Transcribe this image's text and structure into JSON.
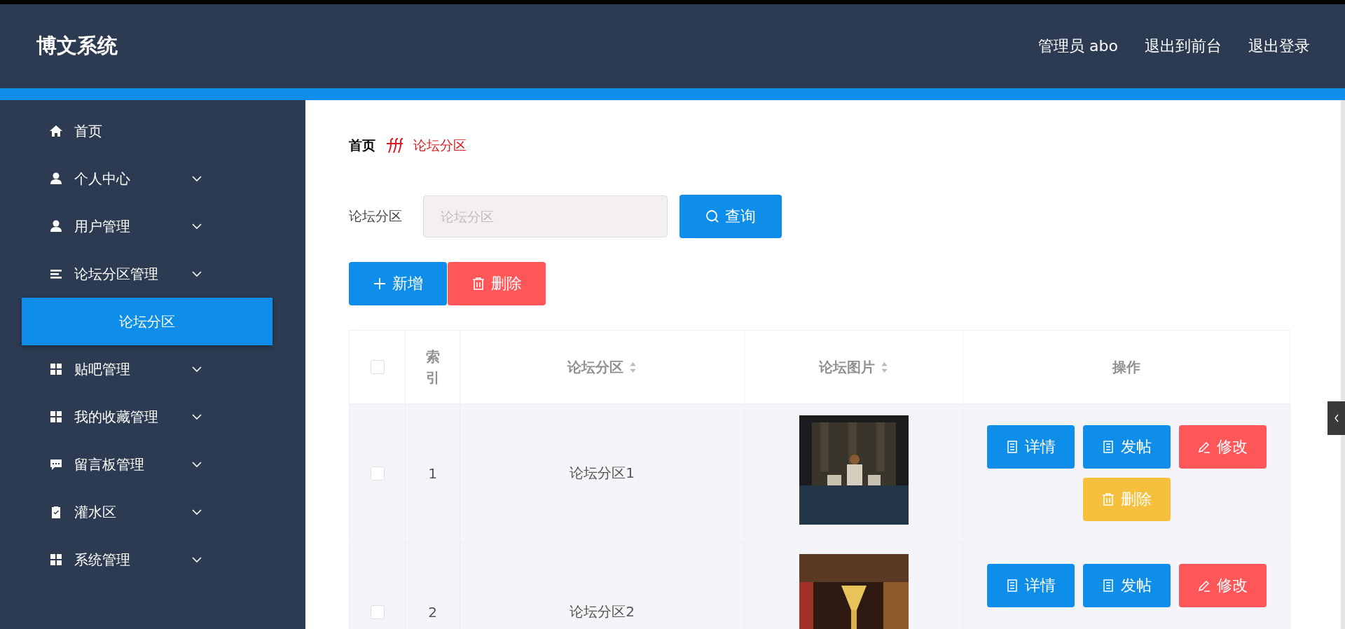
{
  "header": {
    "title": "博文系统",
    "links": [
      "管理员 abo",
      "退出到前台",
      "退出登录"
    ]
  },
  "sidebar": {
    "items": [
      {
        "label": "首页",
        "kind": "home",
        "expandable": false
      },
      {
        "label": "个人中心",
        "kind": "user",
        "expandable": true
      },
      {
        "label": "用户管理",
        "kind": "user",
        "expandable": true
      },
      {
        "label": "论坛分区管理",
        "kind": "list",
        "expandable": true,
        "children": [
          {
            "label": "论坛分区",
            "selected": true
          }
        ]
      },
      {
        "label": "贴吧管理",
        "kind": "grid",
        "expandable": true
      },
      {
        "label": "我的收藏管理",
        "kind": "grid",
        "expandable": true
      },
      {
        "label": "留言板管理",
        "kind": "chat",
        "expandable": true
      },
      {
        "label": "灌水区",
        "kind": "clipboard",
        "expandable": true
      },
      {
        "label": "系统管理",
        "kind": "grid",
        "expandable": true
      }
    ]
  },
  "breadcrumb": [
    "首页",
    "论坛分区"
  ],
  "search": {
    "label": "论坛分区",
    "placeholder": "论坛分区",
    "button": "查询"
  },
  "actions": [
    {
      "label": "新增",
      "kind": "add"
    },
    {
      "label": "删除",
      "kind": "delete"
    }
  ],
  "table": {
    "header_checked": false,
    "columns": [
      {
        "label": "索引",
        "sortable": false
      },
      {
        "label": "论坛分区",
        "sortable": true
      },
      {
        "label": "论坛图片",
        "sortable": true
      },
      {
        "label": "操作",
        "sortable": false
      }
    ],
    "rows": [
      {
        "checked": false,
        "index": "1",
        "name": "论坛分区1",
        "buttons": [
          {
            "label": "详情",
            "kind": "detail"
          },
          {
            "label": "发帖",
            "kind": "post"
          },
          {
            "label": "修改",
            "kind": "edit"
          },
          {
            "label": "删除",
            "kind": "delete"
          }
        ]
      },
      {
        "checked": false,
        "index": "2",
        "name": "论坛分区2",
        "buttons": [
          {
            "label": "详情",
            "kind": "detail"
          },
          {
            "label": "发帖",
            "kind": "post"
          },
          {
            "label": "修改",
            "kind": "edit"
          }
        ]
      }
    ]
  }
}
